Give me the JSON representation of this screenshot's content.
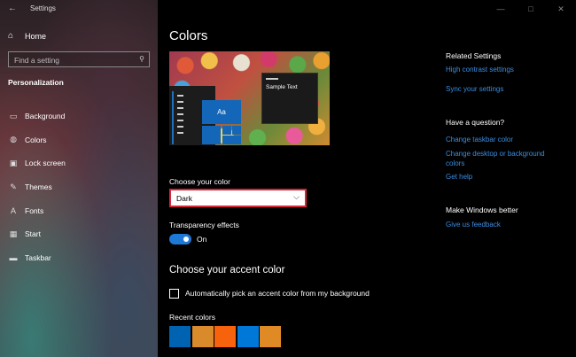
{
  "window": {
    "title": "Settings",
    "controls": [
      "—",
      "□",
      "✕"
    ]
  },
  "sidebar": {
    "home_label": "Home",
    "search_placeholder": "Find a setting",
    "section_title": "Personalization",
    "items": [
      {
        "label": "Background",
        "icon": "picture-icon"
      },
      {
        "label": "Colors",
        "icon": "palette-icon"
      },
      {
        "label": "Lock screen",
        "icon": "lock-screen-icon"
      },
      {
        "label": "Themes",
        "icon": "brush-icon"
      },
      {
        "label": "Fonts",
        "icon": "font-icon"
      },
      {
        "label": "Start",
        "icon": "start-icon"
      },
      {
        "label": "Taskbar",
        "icon": "taskbar-icon"
      }
    ]
  },
  "main": {
    "title": "Colors",
    "preview": {
      "sample_text": "Sample Text",
      "tile_text": "Aa"
    },
    "choose_color_label": "Choose your color",
    "choose_color_value": "Dark",
    "transparency_label": "Transparency effects",
    "transparency_state": "On",
    "accent_heading": "Choose your accent color",
    "auto_accent_label": "Automatically pick an accent color from my background",
    "recent_colors_label": "Recent colors",
    "recent_colors": [
      "#0063b1",
      "#d98a2b",
      "#f7630c",
      "#0078d7",
      "#e08a26"
    ]
  },
  "right": {
    "related_heading": "Related Settings",
    "related_links": [
      "High contrast settings",
      "Sync your settings"
    ],
    "question_heading": "Have a question?",
    "question_links": [
      "Change taskbar color",
      "Change desktop or background colors",
      "Get help"
    ],
    "better_heading": "Make Windows better",
    "better_links": [
      "Give us feedback"
    ]
  },
  "colors": {
    "accent": "#1e78d6",
    "link": "#3b8de0",
    "highlight_border": "#d8263a"
  }
}
